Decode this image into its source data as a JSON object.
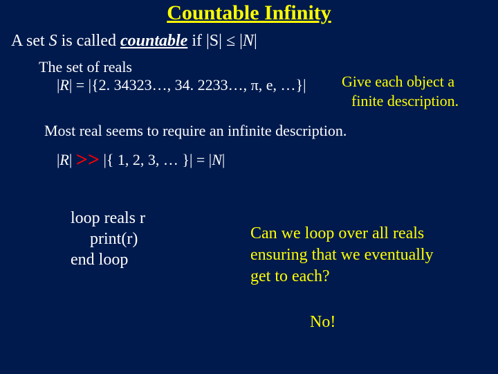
{
  "title": "Countable Infinity",
  "def": {
    "pre": "A set ",
    "S": "S",
    "mid1": " is called ",
    "countable": "countable",
    "mid2": " if |S| ≤ |",
    "N": "N",
    "post": "|"
  },
  "set_of_reals": "The set of reals",
  "reals_eq": {
    "lhs": "|",
    "R": "R",
    "rest": "| = |{2. 34323…, 34. 2233…, π, e, …}|"
  },
  "give_each": {
    "l1": "Give each object a",
    "l2": "finite description."
  },
  "most_real": "Most real seems to require an infinite description.",
  "rline": {
    "bar1": "|",
    "R": "R",
    "bar2": "|  ",
    "gg": ">>",
    "mid": "  |{ 1,   2,   3,   … }|  =  |",
    "N": "N",
    "end": "|"
  },
  "loopcode": {
    "l1": "loop  reals r",
    "l2": "print(r)",
    "l3": "end loop"
  },
  "canweloop": {
    "l1": "Can we loop over all reals",
    "l2": "ensuring that we eventually",
    "l3": "get to each?"
  },
  "no": "No!"
}
